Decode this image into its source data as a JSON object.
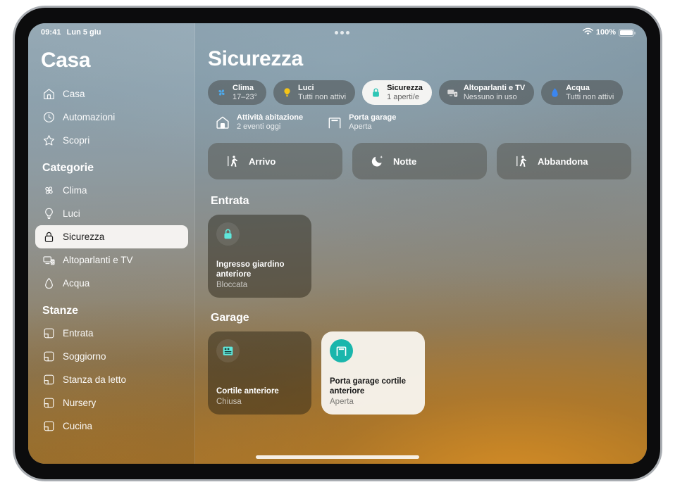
{
  "statusbar": {
    "time": "09:41",
    "date": "Lun 5 giu",
    "battery_percent": "100%",
    "wifi_icon": "wifi-icon",
    "battery_icon": "battery-full-icon",
    "multitask_icon": "multitasking-dots-icon"
  },
  "sidebar": {
    "title": "Casa",
    "nav": [
      {
        "label": "Casa",
        "icon": "house-icon",
        "selected": false
      },
      {
        "label": "Automazioni",
        "icon": "clock-automation-icon",
        "selected": false
      },
      {
        "label": "Scopri",
        "icon": "star-icon",
        "selected": false
      }
    ],
    "categories_title": "Categorie",
    "categories": [
      {
        "label": "Clima",
        "icon": "fan-icon",
        "selected": false
      },
      {
        "label": "Luci",
        "icon": "lightbulb-icon",
        "selected": false
      },
      {
        "label": "Sicurezza",
        "icon": "lock-icon",
        "selected": true
      },
      {
        "label": "Altoparlanti e TV",
        "icon": "tv-speaker-icon",
        "selected": false
      },
      {
        "label": "Acqua",
        "icon": "water-drop-icon",
        "selected": false
      }
    ],
    "rooms_title": "Stanze",
    "rooms": [
      {
        "label": "Entrata",
        "icon": "room-icon"
      },
      {
        "label": "Soggiorno",
        "icon": "room-icon"
      },
      {
        "label": "Stanza da letto",
        "icon": "room-icon"
      },
      {
        "label": "Nursery",
        "icon": "room-icon"
      },
      {
        "label": "Cucina",
        "icon": "room-icon"
      }
    ]
  },
  "main": {
    "title": "Sicurezza",
    "chips": [
      {
        "name": "Clima",
        "status": "17–23°",
        "icon": "fan-icon",
        "icon_color": "#4fa8e8",
        "active": false
      },
      {
        "name": "Luci",
        "status": "Tutti non attivi",
        "icon": "lightbulb-icon",
        "icon_color": "#f5c417",
        "active": false
      },
      {
        "name": "Sicurezza",
        "status": "1 aperti/e",
        "icon": "lock-icon",
        "icon_color": "#2ec6b6",
        "active": true
      },
      {
        "name": "Altoparlanti e TV",
        "status": "Nessuno in uso",
        "icon": "tv-speaker-icon",
        "icon_color": "#d6d6d6",
        "active": false
      },
      {
        "name": "Acqua",
        "status": "Tutti non attivi",
        "icon": "water-drop-icon",
        "icon_color": "#3b86f0",
        "active": false
      }
    ],
    "info": [
      {
        "name": "Attività abitazione",
        "status": "2 eventi oggi",
        "icon": "house-icon"
      },
      {
        "name": "Porta garage",
        "status": "Aperta",
        "icon": "garage-open-icon"
      }
    ],
    "scenes": [
      {
        "label": "Arrivo",
        "icon": "person-arriving-icon"
      },
      {
        "label": "Notte",
        "icon": "moon-stars-icon"
      },
      {
        "label": "Abbandona",
        "icon": "person-leaving-icon"
      }
    ],
    "sections": [
      {
        "title": "Entrata",
        "tiles": [
          {
            "name": "Ingresso giardino anteriore",
            "state": "Bloccata",
            "icon": "lock-closed-icon",
            "on": false
          }
        ]
      },
      {
        "title": "Garage",
        "tiles": [
          {
            "name": "Cortile anteriore",
            "state": "Chiusa",
            "icon": "garage-closed-icon",
            "on": false
          },
          {
            "name": "Porta garage cortile anteriore",
            "state": "Aperta",
            "icon": "garage-open-icon",
            "on": true
          }
        ]
      }
    ]
  },
  "colors": {
    "accent_teal": "#1ab6ac",
    "icon_teal": "#5fe8dc",
    "selection_light": "#faf9f6"
  }
}
